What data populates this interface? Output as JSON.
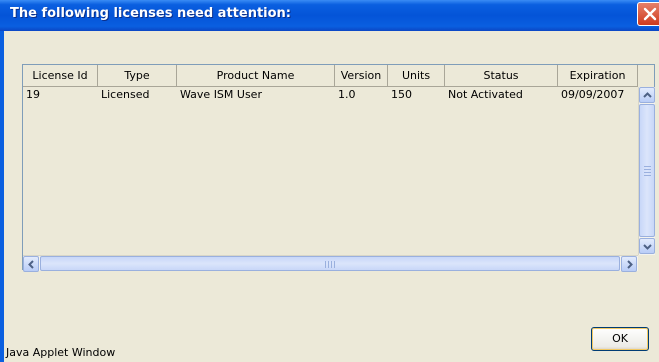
{
  "window": {
    "title": "The following licenses need attention:",
    "status_text": "Java Applet Window"
  },
  "table": {
    "columns": [
      "License Id",
      "Type",
      "Product Name",
      "Version",
      "Units",
      "Status",
      "Expiration"
    ],
    "rows": [
      [
        "19",
        "Licensed",
        "Wave ISM User",
        "1.0",
        "150",
        "Not Activated",
        "09/09/2007"
      ]
    ]
  },
  "buttons": {
    "ok_label": "OK"
  },
  "icons": {
    "close": "close-icon",
    "scroll_up": "arrow-up-icon",
    "scroll_down": "arrow-down-icon",
    "scroll_left": "arrow-left-icon",
    "scroll_right": "arrow-right-icon"
  },
  "colors": {
    "titlebar": "#0454d8",
    "close_button": "#cf3a1e",
    "dialog_background": "#ece9d8"
  }
}
